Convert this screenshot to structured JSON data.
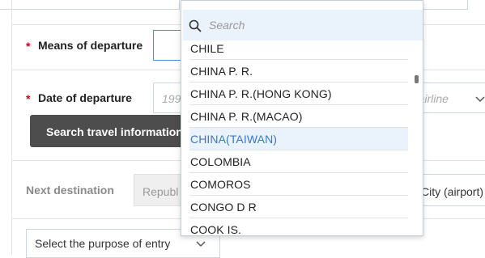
{
  "form": {
    "means_label": "Means of departure",
    "date_label": "Date of departure",
    "date_placeholder": "199",
    "airline_placeholder": "r airline",
    "search_button": "Search travel information",
    "next_destination_label": "Next destination",
    "next_destination_value": "Republ",
    "city_value": "City (airport)",
    "purpose_select": "Select the purpose of entry"
  },
  "dropdown": {
    "search_placeholder": "Search",
    "options": [
      {
        "label": "CHILE",
        "selected": false
      },
      {
        "label": "CHINA P. R.",
        "selected": false
      },
      {
        "label": "CHINA P. R.(HONG KONG)",
        "selected": false
      },
      {
        "label": "CHINA P. R.(MACAO)",
        "selected": false
      },
      {
        "label": "CHINA(TAIWAN)",
        "selected": true
      },
      {
        "label": "COLOMBIA",
        "selected": false
      },
      {
        "label": "COMOROS",
        "selected": false
      },
      {
        "label": "CONGO D R",
        "selected": false
      },
      {
        "label": "COOK IS.",
        "selected": false
      }
    ]
  },
  "colors": {
    "required": "#d0021b",
    "button_bg": "#4d4d4d",
    "selected_text": "#3a78c2",
    "selected_bg": "#eaf3fb"
  },
  "icons": {
    "search": "search-icon",
    "chevron": "chevron-down-icon"
  }
}
